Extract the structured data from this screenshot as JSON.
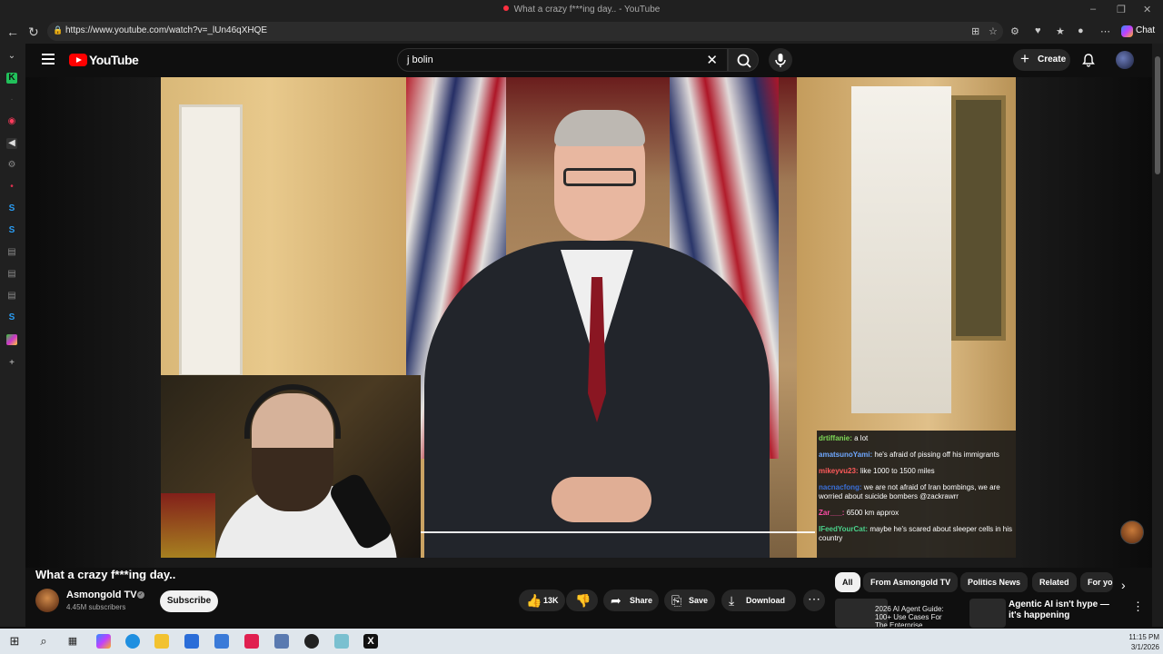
{
  "window": {
    "title": "What a crazy f***ing day.. - YouTube",
    "minimize": "–",
    "restore": "❐",
    "close": "✕"
  },
  "browser": {
    "url": "https://www.youtube.com/watch?v=_lUn46qXHQE",
    "chat_label": "Chat"
  },
  "youtube": {
    "logo_text": "YouTube",
    "search_query": "j bolin",
    "create_label": "Create"
  },
  "video": {
    "title": "What a crazy f***ing day..",
    "channel": "Asmongold TV",
    "subscribers": "4.45M subscribers",
    "subscribe_label": "Subscribe",
    "likes": "13K",
    "share_label": "Share",
    "save_label": "Save",
    "download_label": "Download",
    "chat_overlay": [
      {
        "user": "drtiffanie:",
        "text": "a lot",
        "color": "#7ed957"
      },
      {
        "user": "amatsunoYami:",
        "text": "he's afraid of pissing off his immigrants",
        "color": "#6fa8ff"
      },
      {
        "user": "mikeyvu23:",
        "text": "like 1000 to 1500 miles",
        "color": "#ff5a5a"
      },
      {
        "user": "nacnacfong:",
        "text": "we are not afraid of Iran bombings, we are worried about suicide bombers @zackrawrr",
        "color": "#3a6fd8"
      },
      {
        "user": "Zar___:",
        "text": "6500 km approx",
        "color": "#ff4da6"
      },
      {
        "user": "IFeedYourCat:",
        "text": "maybe he's scared about sleeper cells in his country",
        "color": "#4ad08a"
      }
    ]
  },
  "chips": [
    "All",
    "From Asmongold TV",
    "Politics News",
    "Related",
    "For yo"
  ],
  "recommendations": [
    {
      "title": "2026 AI Agent Guide: 100+ Use Cases For The Enterprise"
    },
    {
      "title": "Agentic AI isn't hype — it's happening"
    }
  ],
  "taskbar": {
    "time": "11:15 PM",
    "date": "3/1/2026"
  }
}
